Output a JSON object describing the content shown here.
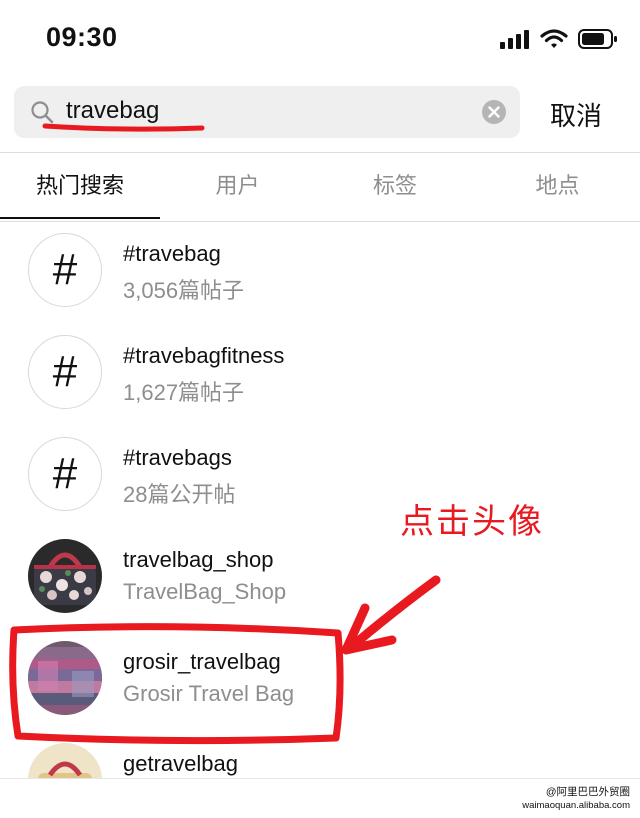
{
  "status_bar": {
    "time": "09:30"
  },
  "search": {
    "value": "travebag",
    "cancel_label": "取消"
  },
  "tabs": [
    {
      "label": "热门搜索",
      "active": true
    },
    {
      "label": "用户",
      "active": false
    },
    {
      "label": "标签",
      "active": false
    },
    {
      "label": "地点",
      "active": false
    }
  ],
  "results": [
    {
      "kind": "hashtag",
      "symbol": "#",
      "title": "#travebag",
      "subtitle": "3,056篇帖子"
    },
    {
      "kind": "hashtag",
      "symbol": "#",
      "title": "#travebagfitness",
      "subtitle": "1,627篇帖子"
    },
    {
      "kind": "hashtag",
      "symbol": "#",
      "title": "#travebags",
      "subtitle": "28篇公开帖"
    },
    {
      "kind": "user",
      "title": "travelbag_shop",
      "subtitle": "TravelBag_Shop"
    },
    {
      "kind": "user",
      "title": "grosir_travelbag",
      "subtitle": "Grosir Travel Bag"
    },
    {
      "kind": "user",
      "title": "getravelbag",
      "subtitle": ""
    }
  ],
  "annotation": {
    "text": "点击头像",
    "color": "#e8191f"
  },
  "watermark": {
    "line1": "@阿里巴巴外贸圈",
    "line2": "waimaoquan.alibaba.com"
  }
}
